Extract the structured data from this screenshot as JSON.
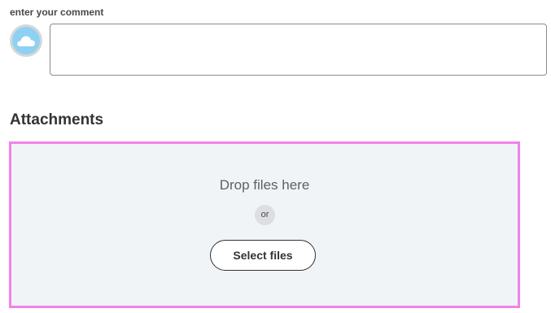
{
  "comment": {
    "label": "enter your comment",
    "value": "",
    "placeholder": ""
  },
  "attachments": {
    "title": "Attachments",
    "drop_text": "Drop files here",
    "or_text": "or",
    "select_button_label": "Select files"
  },
  "icons": {
    "avatar": "cloud-icon"
  },
  "colors": {
    "dropzone_border": "#f182ea",
    "dropzone_background": "#f1f4f6",
    "avatar_background": "#8fd1f2"
  }
}
